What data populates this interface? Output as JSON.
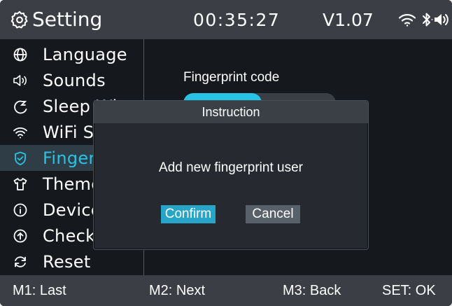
{
  "header": {
    "title": "Setting",
    "clock": "00:35:27",
    "version": "V1.07",
    "icons": [
      "gear-icon",
      "wifi-icon",
      "bluetooth-icon",
      "speaker-icon"
    ]
  },
  "sidebar": {
    "items": [
      {
        "label": "Language",
        "icon": "globe-icon",
        "active": false
      },
      {
        "label": "Sounds",
        "icon": "speaker-icon",
        "active": false
      },
      {
        "label": "Sleep Wi",
        "icon": "sleep-icon",
        "active": false
      },
      {
        "label": "WiFi Se",
        "icon": "wifi-icon",
        "active": false
      },
      {
        "label": "Finger",
        "icon": "shield-icon",
        "active": true
      },
      {
        "label": "Theme",
        "icon": "shirt-icon",
        "active": false
      },
      {
        "label": "Device",
        "icon": "info-icon",
        "active": false
      },
      {
        "label": "Check",
        "icon": "upload-icon",
        "active": false
      },
      {
        "label": "Reset",
        "icon": "reset-icon",
        "active": false
      }
    ]
  },
  "content": {
    "fingerprint_label": "Fingerprint code"
  },
  "dialog": {
    "title": "Instruction",
    "message": "Add new fingerprint user",
    "confirm_label": "Confirm",
    "cancel_label": "Cancel"
  },
  "footer": {
    "m1": "M1:  Last",
    "m2": "M2: Next",
    "m3": "M3:  Back",
    "set": "SET: OK"
  },
  "colors": {
    "accent": "#27c3e6",
    "bar": "#3b3e44",
    "background": "#15181c"
  }
}
